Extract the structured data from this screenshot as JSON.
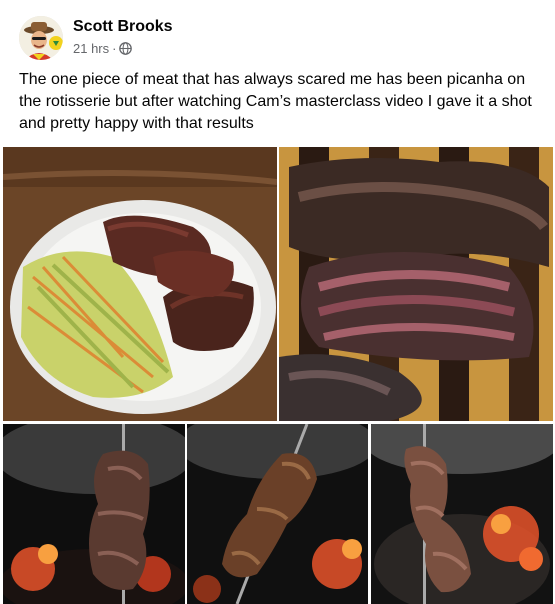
{
  "post": {
    "author": "Scott Brooks",
    "time": "21 hrs",
    "separator": "·",
    "audience_icon": "globe-icon",
    "text": "The one piece of meat that has always scared me has been picanha on the rotisserie but after watching Cam’s masterclass video I gave it a shot and pretty happy with that results",
    "photos": [
      {
        "label": "plated-picanha-with-slaw"
      },
      {
        "label": "sliced-picanha-on-board"
      },
      {
        "label": "rotisserie-picanha-1"
      },
      {
        "label": "rotisserie-picanha-2"
      },
      {
        "label": "rotisserie-picanha-3"
      }
    ]
  },
  "colors": {
    "text": "#050505",
    "meta": "#65676b",
    "background": "#ffffff"
  }
}
